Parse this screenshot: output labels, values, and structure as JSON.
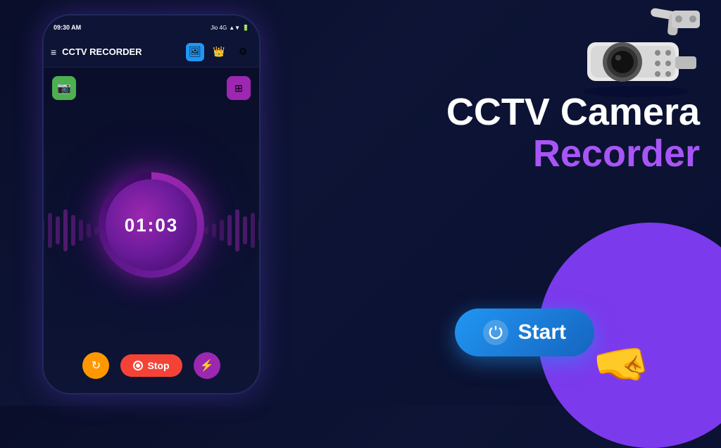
{
  "app": {
    "status_bar": {
      "time": "09:30 AM",
      "carrier": "Jio 4G",
      "signal": "▲▼",
      "battery": "█"
    },
    "app_bar": {
      "title": "CCTV RECORDER",
      "icon_gallery": "🖼",
      "icon_crown": "👑",
      "icon_settings": "⚙"
    },
    "timer": {
      "value": "01:03"
    },
    "buttons": {
      "stop_label": "Stop",
      "start_label": "Start",
      "camera_top": "📷",
      "flash": "⚡"
    }
  },
  "right_panel": {
    "title_line1": "CCTV Camera",
    "title_line2": "Recorder",
    "start_button": "Start"
  }
}
